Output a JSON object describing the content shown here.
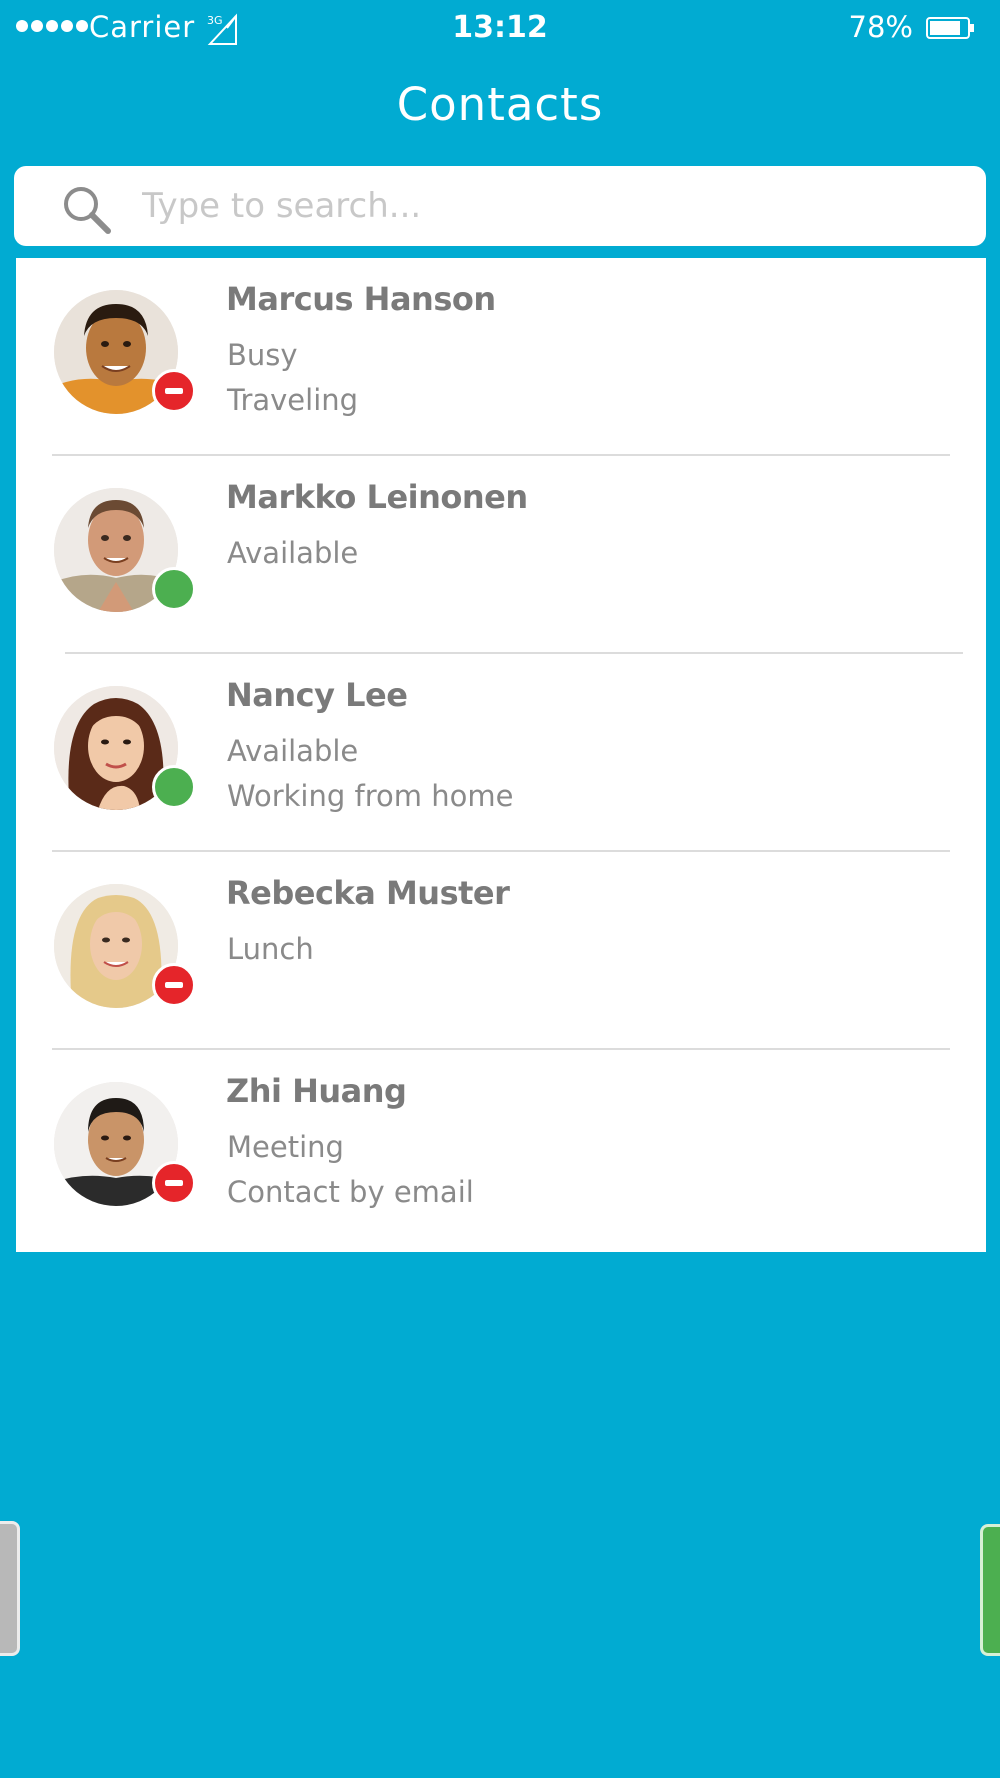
{
  "status_bar": {
    "carrier": "Carrier",
    "network": "3G",
    "time": "13:12",
    "battery_percent": "78%"
  },
  "header": {
    "title": "Contacts"
  },
  "search": {
    "placeholder": "Type to search..."
  },
  "contacts": [
    {
      "name": "Marcus Hanson",
      "status": "Busy",
      "note": "Traveling",
      "presence": "busy"
    },
    {
      "name": "Markko Leinonen",
      "status": "Available",
      "note": "",
      "presence": "available"
    },
    {
      "name": "Nancy Lee",
      "status": "Available",
      "note": "Working from home",
      "presence": "available"
    },
    {
      "name": "Rebecka Muster",
      "status": "Lunch",
      "note": "",
      "presence": "busy"
    },
    {
      "name": "Zhi Huang",
      "status": "Meeting",
      "note": "Contact by email",
      "presence": "busy"
    }
  ],
  "colors": {
    "background": "#01abd2",
    "busy": "#e5252a",
    "available": "#4caf50",
    "text": "#7a7a7a"
  }
}
